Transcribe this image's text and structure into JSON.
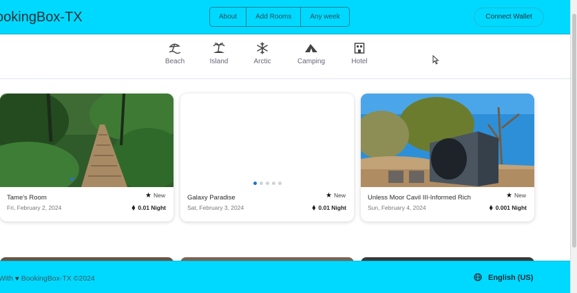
{
  "header": {
    "logo": "ookingBox-TX",
    "nav": [
      "About",
      "Add Rooms",
      "Any week"
    ],
    "connect_wallet": "Connect Wallet"
  },
  "categories": [
    {
      "label": "Beach",
      "icon": "beach-umbrella-icon"
    },
    {
      "label": "Island",
      "icon": "palm-island-icon"
    },
    {
      "label": "Arctic",
      "icon": "snowflake-icon"
    },
    {
      "label": "Camping",
      "icon": "tent-icon"
    },
    {
      "label": "Hotel",
      "icon": "hotel-building-icon"
    }
  ],
  "listings": [
    {
      "title": "Tame's Room",
      "date": "Fri, February 2, 2024",
      "badge": "New",
      "price": "0.01 Night",
      "image": "forest-boardwalk-photo"
    },
    {
      "title": "Galaxy Paradise",
      "date": "Sat, February 3, 2024",
      "badge": "New",
      "price": "0.01 Night",
      "image": "blank-photo",
      "carousel_dots": 5,
      "active_dot": 0
    },
    {
      "title": "Unless Moor Cavil III-Informed Rich",
      "date": "Sun, February 4, 2024",
      "badge": "New",
      "price": "0.001 Night",
      "image": "cube-cabin-photo"
    }
  ],
  "footer": {
    "copyright_prefix": "With",
    "copyright": "BookingBox-TX ©2024",
    "language": "English (US)"
  },
  "colors": {
    "accent": "#00d9ff",
    "active_dot": "#1f6fd1"
  }
}
